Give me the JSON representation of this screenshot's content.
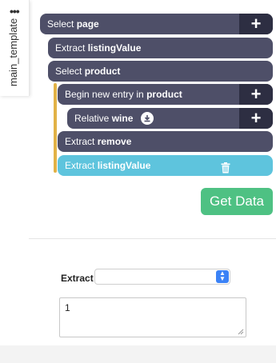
{
  "sidebar": {
    "menu_icon": "more-dots-icon",
    "tab_label": "main_template"
  },
  "commands": [
    {
      "prefix": "Select",
      "target": "page",
      "has_plus": true
    },
    {
      "prefix": "Extract",
      "target": "listingValue"
    },
    {
      "prefix": "Select",
      "target": "product"
    },
    {
      "prefix": "Begin new entry in",
      "target": "product",
      "has_plus": true
    },
    {
      "prefix": "Relative",
      "target": "wine",
      "has_plus": true,
      "icon": "download-icon"
    },
    {
      "prefix": "Extract",
      "target": "remove"
    },
    {
      "prefix": "Extract",
      "target": "listingValue",
      "selected": true,
      "icon": "trash-icon"
    }
  ],
  "plus_symbol": "+",
  "get_data_label": "Get Data",
  "form": {
    "extract_label": "Extract",
    "select_value": "",
    "textarea_value": "1"
  },
  "colors": {
    "command_bg": "#4e4f68",
    "plus_bg": "#2d2e42",
    "selected_bg": "#5ec4dd",
    "loop_bar": "#e2b246",
    "get_data_bg": "#4ec183"
  }
}
